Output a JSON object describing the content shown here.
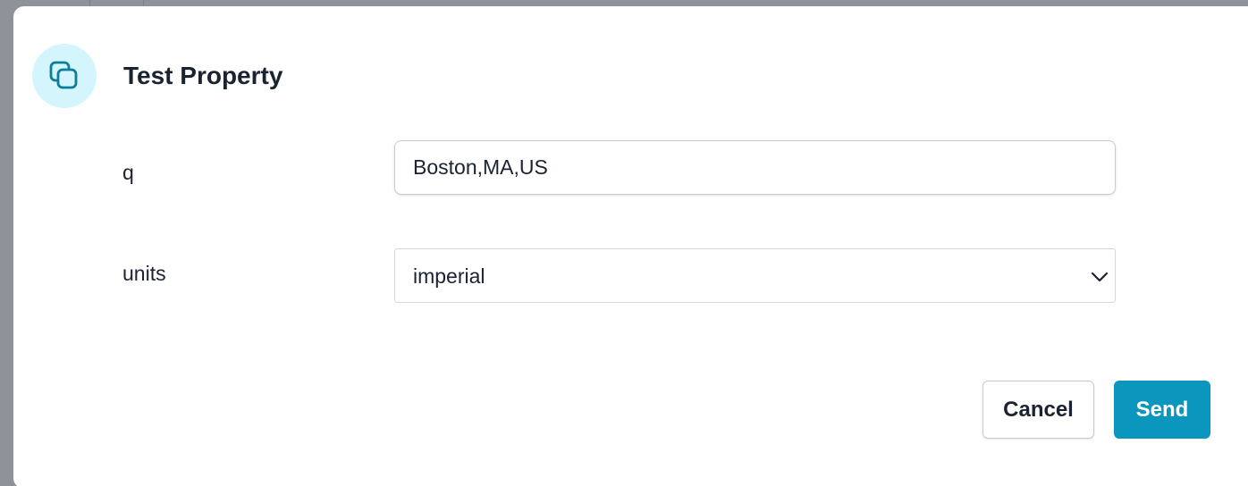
{
  "dialog": {
    "title": "Test Property",
    "header_icon": "copy-icon",
    "accent_color": "#0b97bd",
    "icon_bg_color": "#d3f5fb"
  },
  "fields": {
    "q": {
      "label": "q",
      "value": "Boston,MA,US"
    },
    "units": {
      "label": "units",
      "selected": "imperial",
      "icon": "chevron-down-icon"
    }
  },
  "actions": {
    "cancel_label": "Cancel",
    "send_label": "Send"
  }
}
